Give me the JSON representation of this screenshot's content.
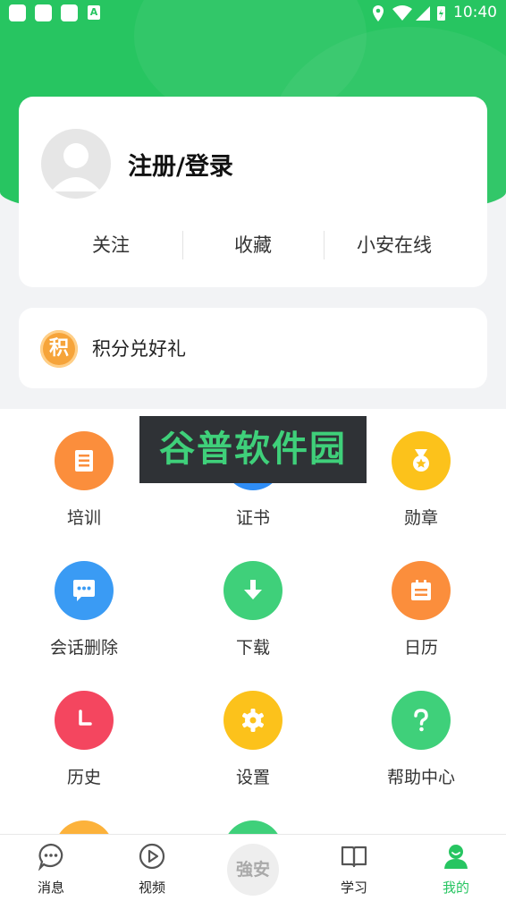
{
  "status_bar": {
    "time": "10:40",
    "notification_badge": "A"
  },
  "profile": {
    "login_label": "注册/登录",
    "stats": [
      "关注",
      "收藏",
      "小安在线"
    ]
  },
  "points": {
    "icon_char": "积",
    "label": "积分兑好礼"
  },
  "watermark": "谷普软件园",
  "grid": [
    {
      "label": "培训",
      "icon": "book-icon",
      "color": "#fb8e3c"
    },
    {
      "label": "证书",
      "icon": "certificate-icon",
      "color": "#2f8df5"
    },
    {
      "label": "勋章",
      "icon": "medal-icon",
      "color": "#fcc21b"
    },
    {
      "label": "会话删除",
      "icon": "chat-icon",
      "color": "#3a9bf4"
    },
    {
      "label": "下载",
      "icon": "download-icon",
      "color": "#3fd07a"
    },
    {
      "label": "日历",
      "icon": "calendar-icon",
      "color": "#fb8e3c"
    },
    {
      "label": "历史",
      "icon": "clock-icon",
      "color": "#f4465f"
    },
    {
      "label": "设置",
      "icon": "gear-icon",
      "color": "#fcc21b"
    },
    {
      "label": "帮助中心",
      "icon": "question-icon",
      "color": "#3fd07a"
    }
  ],
  "tabbar": {
    "items": [
      "消息",
      "视频",
      "学习",
      "我的"
    ],
    "center_logo": "強安",
    "active": "我的",
    "active_color": "#27c561"
  }
}
